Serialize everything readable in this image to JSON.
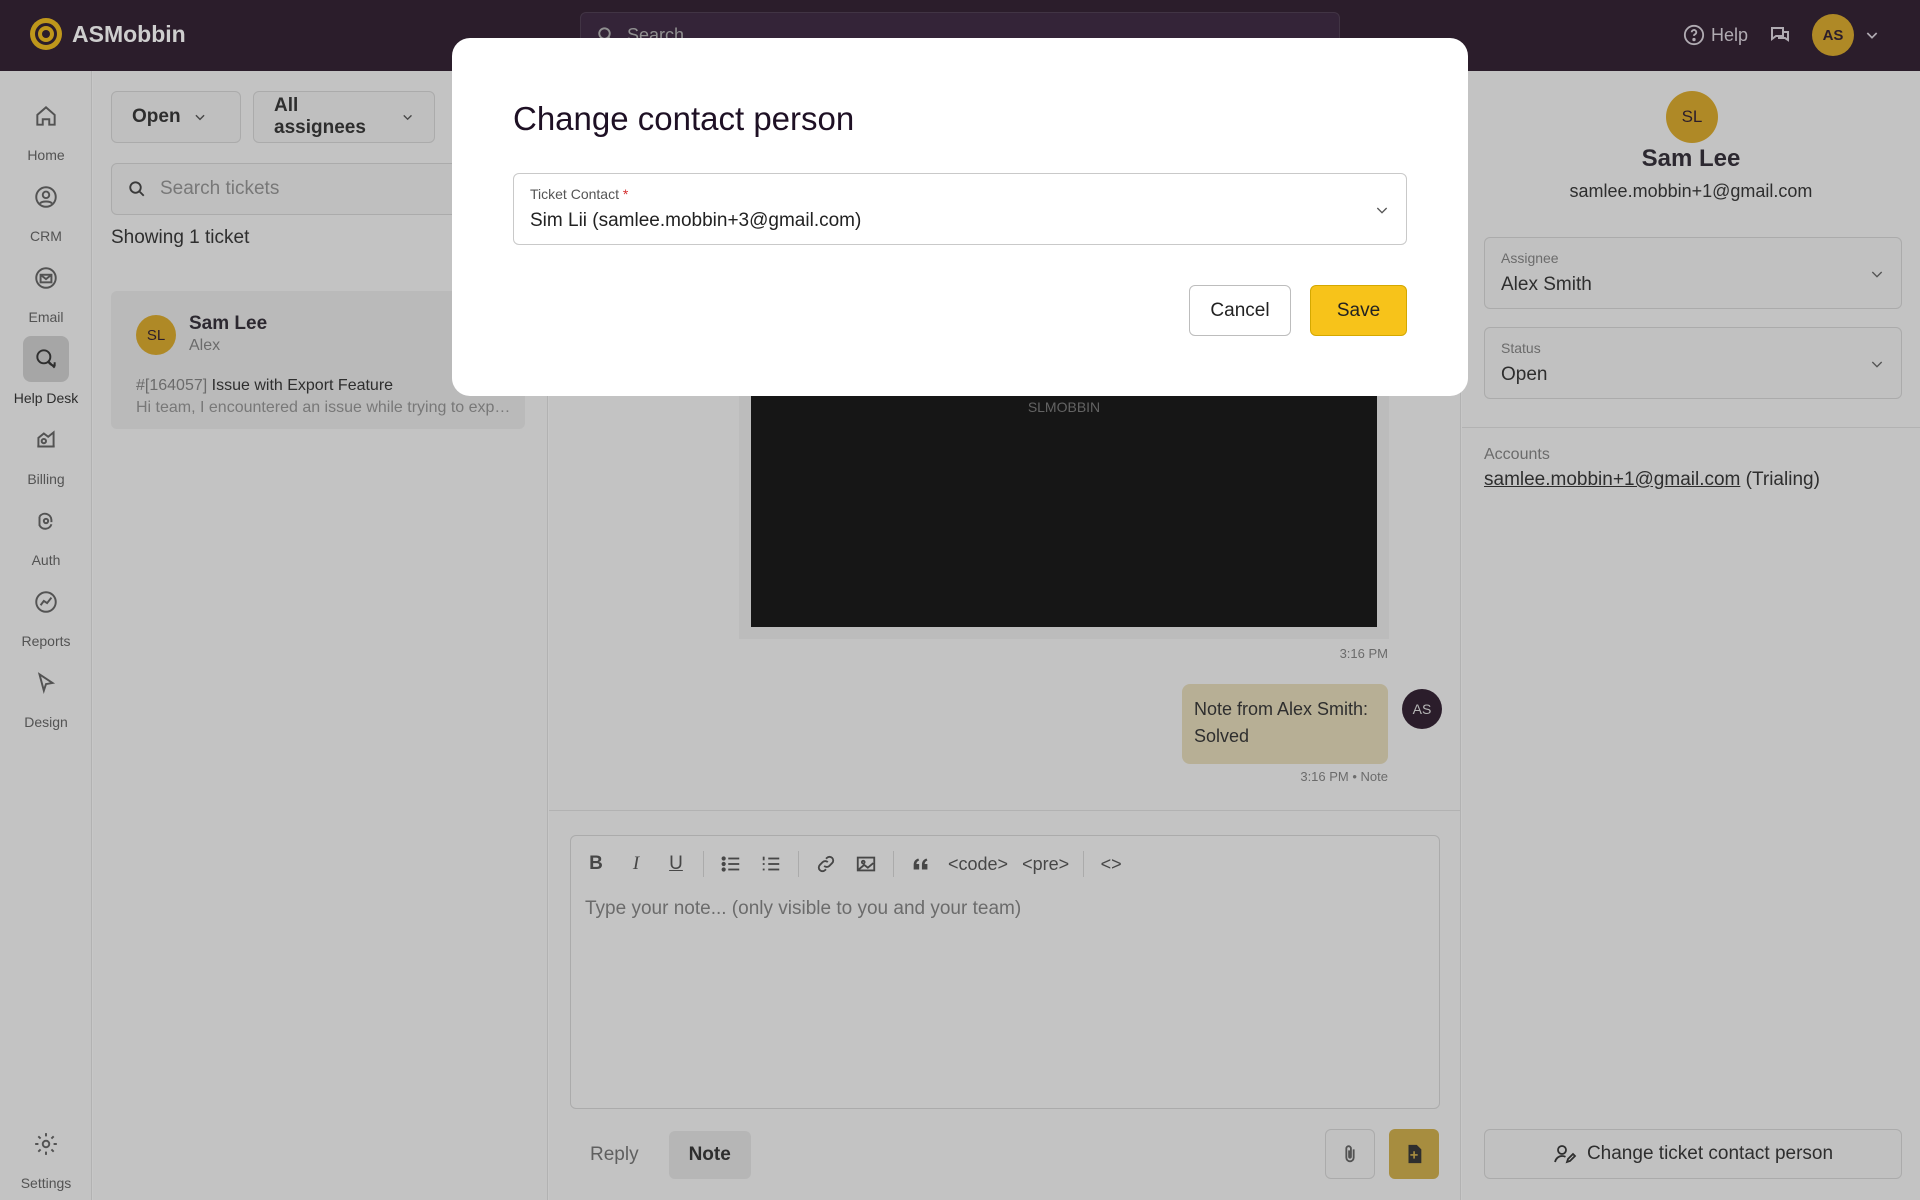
{
  "app": {
    "name": "ASMobbin"
  },
  "topbar": {
    "search_placeholder": "Search",
    "help_label": "Help",
    "user_initials": "AS"
  },
  "nav": {
    "items": [
      {
        "label": "Home",
        "icon": "home-icon"
      },
      {
        "label": "CRM",
        "icon": "crm-icon"
      },
      {
        "label": "Email",
        "icon": "email-icon"
      },
      {
        "label": "Help Desk",
        "icon": "help-desk-icon",
        "active": true
      },
      {
        "label": "Billing",
        "icon": "billing-icon"
      },
      {
        "label": "Auth",
        "icon": "auth-icon"
      },
      {
        "label": "Reports",
        "icon": "reports-icon"
      },
      {
        "label": "Design",
        "icon": "design-icon"
      }
    ],
    "settings_label": "Settings"
  },
  "tickets": {
    "status_filter": "Open",
    "assignee_filter": "All assignees",
    "search_placeholder": "Search tickets",
    "showing_text": "Showing 1 ticket",
    "list": [
      {
        "initials": "SL",
        "name": "Sam Lee",
        "assignee": "Alex",
        "number": "#[164057]",
        "subject": "Issue with Export Feature",
        "preview": "Hi team, I encountered an issue while trying to export my data from the dashboard."
      }
    ]
  },
  "conversation": {
    "video_label": "SLMOBBIN",
    "video_timestamp": "3:16 PM",
    "note_text": "Note from Alex Smith: Solved",
    "note_author_initials": "AS",
    "note_meta": "3:16 PM • Note",
    "editor": {
      "toolbar": [
        "B",
        "I",
        "U",
        "bullet-list",
        "numbered-list",
        "link",
        "image",
        "quote",
        "<code>",
        "<pre>",
        "<>"
      ],
      "placeholder": "Type your note... (only visible to you and your team)"
    },
    "tabs": [
      {
        "label": "Reply"
      },
      {
        "label": "Note",
        "active": true
      }
    ]
  },
  "contact": {
    "initials": "SL",
    "name": "Sam Lee",
    "email": "samlee.mobbin+1@gmail.com",
    "assignee_label": "Assignee",
    "assignee_value": "Alex Smith",
    "status_label": "Status",
    "status_value": "Open",
    "accounts_label": "Accounts",
    "account_email": "samlee.mobbin+1@gmail.com",
    "account_status": "(Trialing)",
    "change_contact_label": "Change ticket contact person"
  },
  "modal": {
    "title": "Change contact person",
    "field_label": "Ticket Contact",
    "required_mark": "*",
    "field_value": "Sim Lii (samlee.mobbin+3@gmail.com)",
    "cancel_label": "Cancel",
    "save_label": "Save"
  },
  "colors": {
    "topbar_bg": "#1e0a1e",
    "accent": "#f7c31a",
    "avatar": "#d4a017"
  }
}
